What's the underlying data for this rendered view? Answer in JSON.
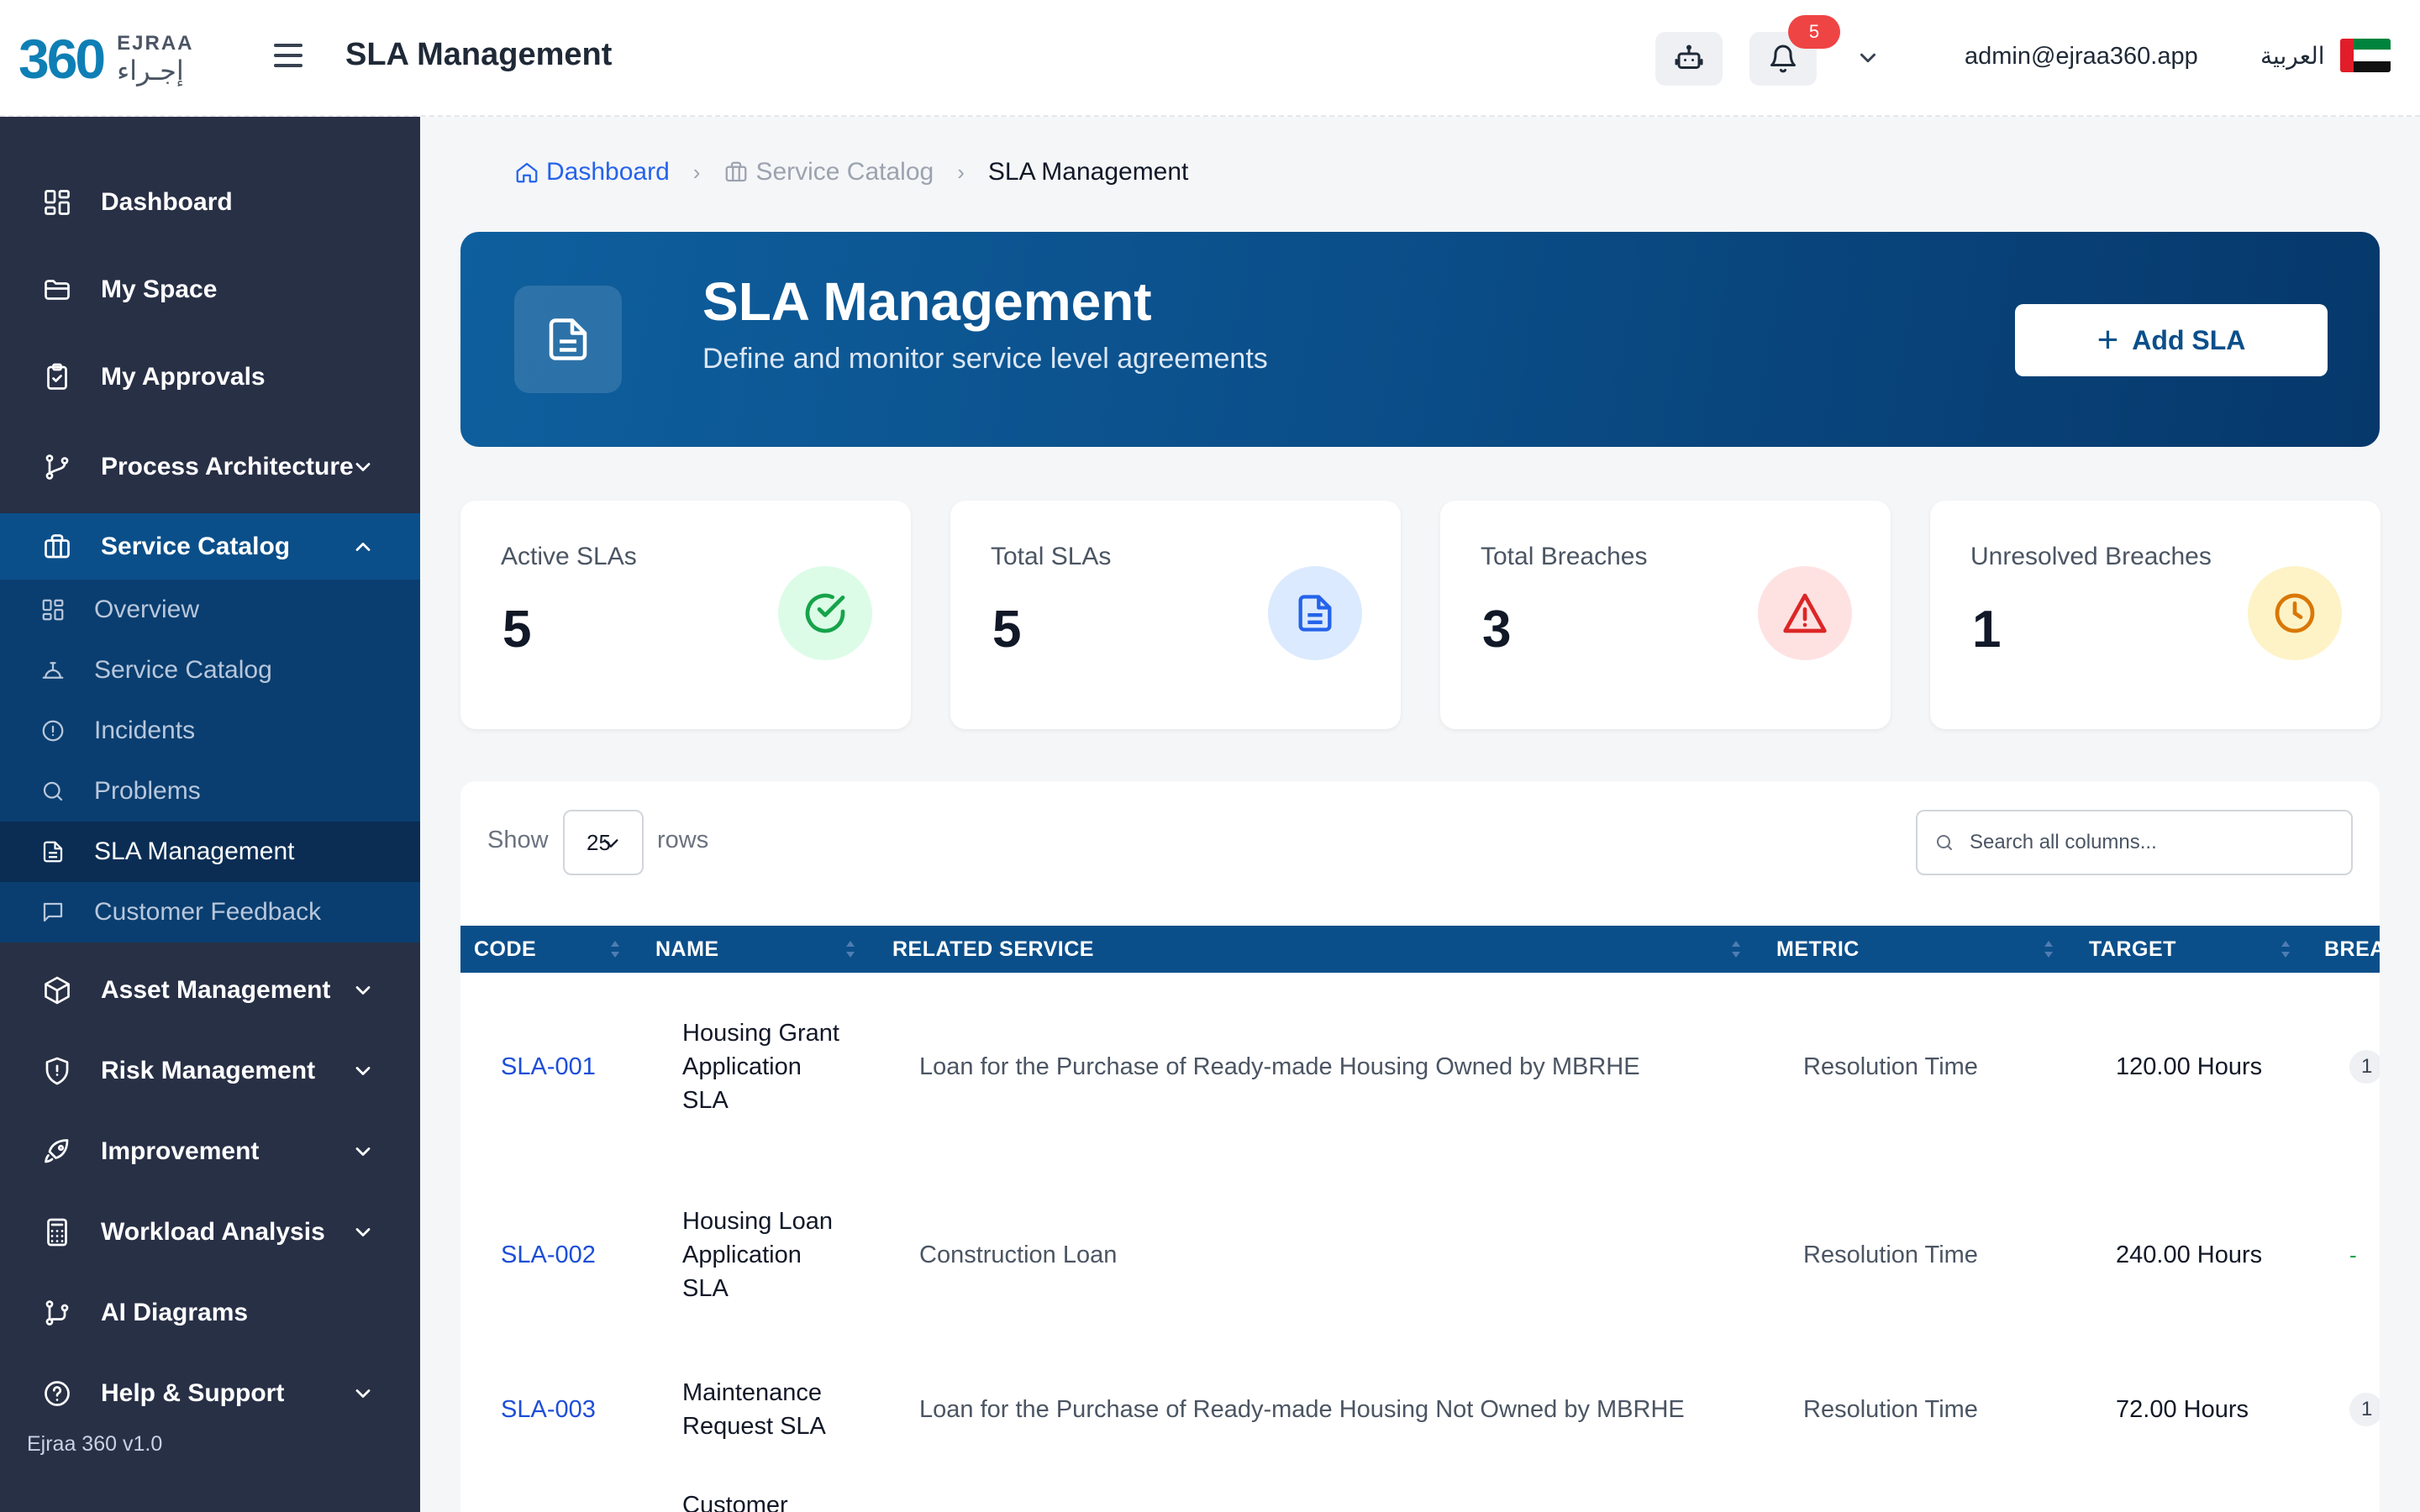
{
  "header": {
    "logo_mark": "360",
    "logo_en": "EJRAA",
    "logo_ar": "إجـراء",
    "title": "SLA Management",
    "notification_count": "5",
    "user_email": "admin@ejraa360.app",
    "language_label": "العربية"
  },
  "sidebar": {
    "items": [
      {
        "label": "Dashboard",
        "icon": "grid-icon"
      },
      {
        "label": "My Space",
        "icon": "folder-icon"
      },
      {
        "label": "My Approvals",
        "icon": "clipboard-check-icon"
      },
      {
        "label": "Process Architecture",
        "icon": "git-branch-icon"
      },
      {
        "label": "Service Catalog",
        "icon": "briefcase-icon"
      },
      {
        "label": "Asset Management",
        "icon": "box-icon"
      },
      {
        "label": "Risk Management",
        "icon": "shield-alert-icon"
      },
      {
        "label": "Improvement",
        "icon": "rocket-icon"
      },
      {
        "label": "Workload Analysis",
        "icon": "calculator-icon"
      },
      {
        "label": "AI Diagrams",
        "icon": "diagram-icon"
      },
      {
        "label": "Help & Support",
        "icon": "help-circle-icon"
      }
    ],
    "sub_items": [
      {
        "label": "Overview",
        "icon": "grid-icon"
      },
      {
        "label": "Service Catalog",
        "icon": "bell-service-icon"
      },
      {
        "label": "Incidents",
        "icon": "alert-circle-icon"
      },
      {
        "label": "Problems",
        "icon": "search-icon"
      },
      {
        "label": "SLA Management",
        "icon": "document-icon"
      },
      {
        "label": "Customer Feedback",
        "icon": "message-square-icon"
      }
    ],
    "version": "Ejraa 360 v1.0"
  },
  "breadcrumb": {
    "home": "Dashboard",
    "parent": "Service Catalog",
    "current": "SLA Management"
  },
  "hero": {
    "title": "SLA Management",
    "subtitle": "Define and monitor service level agreements",
    "add_button": "Add SLA"
  },
  "stats": [
    {
      "label": "Active SLAs",
      "value": "5",
      "icon": "check-circle-icon",
      "color": "#16a34a",
      "bg": "#dcfce7"
    },
    {
      "label": "Total SLAs",
      "value": "5",
      "icon": "document-icon",
      "color": "#2563eb",
      "bg": "#dbeafe"
    },
    {
      "label": "Total Breaches",
      "value": "3",
      "icon": "warning-triangle-icon",
      "color": "#dc2626",
      "bg": "#fee2e2"
    },
    {
      "label": "Unresolved Breaches",
      "value": "1",
      "icon": "clock-icon",
      "color": "#d97706",
      "bg": "#fef3c7"
    }
  ],
  "table": {
    "show_label": "Show",
    "rows_value": "25",
    "rows_label": "rows",
    "search_placeholder": "Search all columns...",
    "columns": [
      "CODE",
      "NAME",
      "RELATED SERVICE",
      "METRIC",
      "TARGET",
      "BREA"
    ],
    "rows": [
      {
        "code": "SLA-001",
        "name": "Housing Grant Application SLA",
        "service": "Loan for the Purchase of Ready-made Housing Owned by MBRHE",
        "metric": "Resolution Time",
        "target": "120.00 Hours",
        "breaches": "1"
      },
      {
        "code": "SLA-002",
        "name": "Housing Loan Application SLA",
        "service": "Construction Loan",
        "metric": "Resolution Time",
        "target": "240.00 Hours",
        "breaches": "-"
      },
      {
        "code": "SLA-003",
        "name": "Maintenance Request SLA",
        "service": "Loan for the Purchase of Ready-made Housing Not Owned by MBRHE",
        "metric": "Resolution Time",
        "target": "72.00 Hours",
        "breaches": "1"
      },
      {
        "code": "",
        "name": "Customer",
        "service": "",
        "metric": "",
        "target": "",
        "breaches": ""
      }
    ]
  },
  "colors": {
    "brand_blue": "#0b4f8a",
    "sidebar_bg": "#283046",
    "link_blue": "#1d4ed8"
  }
}
